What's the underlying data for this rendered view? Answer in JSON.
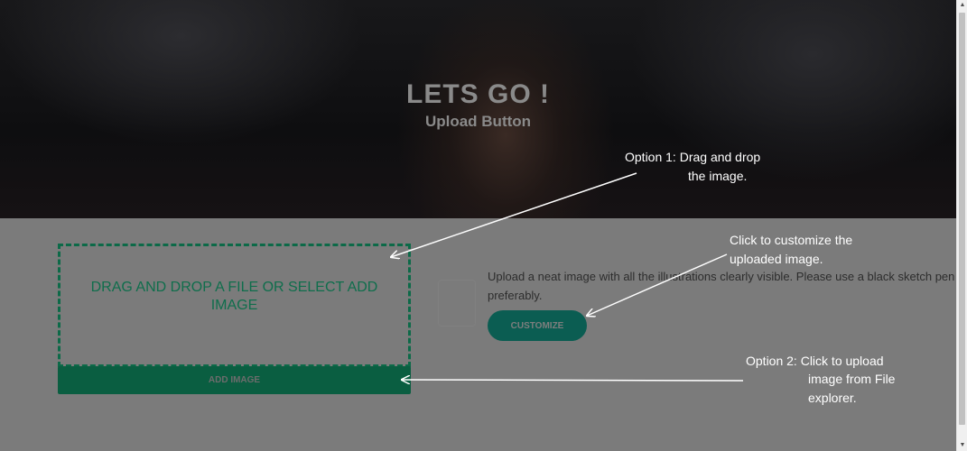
{
  "hero": {
    "title": "LETS GO !",
    "subtitle": "Upload Button"
  },
  "upload": {
    "dropzone_text": "DRAG AND DROP A FILE OR SELECT ADD IMAGE",
    "add_image_label": "ADD IMAGE"
  },
  "customize": {
    "description": "Upload a neat image with all the illustrations clearly visible. Please use a black sketch pen preferably.",
    "button_label": "CUSTOMIZE"
  },
  "annotations": {
    "option1_line1": "Option 1: Drag and drop",
    "option1_line2": "the image.",
    "customize_line1": "Click to customize the",
    "customize_line2": "uploaded image.",
    "option2_line1": "Option 2: Click to upload",
    "option2_line2": "image from File",
    "option2_line3": "explorer."
  },
  "scrollbar": {
    "up_glyph": "▲",
    "down_glyph": "▼"
  },
  "colors": {
    "overlay": "#7b7b7b",
    "dropzone_border": "#0c6a48",
    "add_image_bg": "#0a5e41",
    "customize_bg": "#0b5d52",
    "annotation_text": "#ffffff"
  }
}
